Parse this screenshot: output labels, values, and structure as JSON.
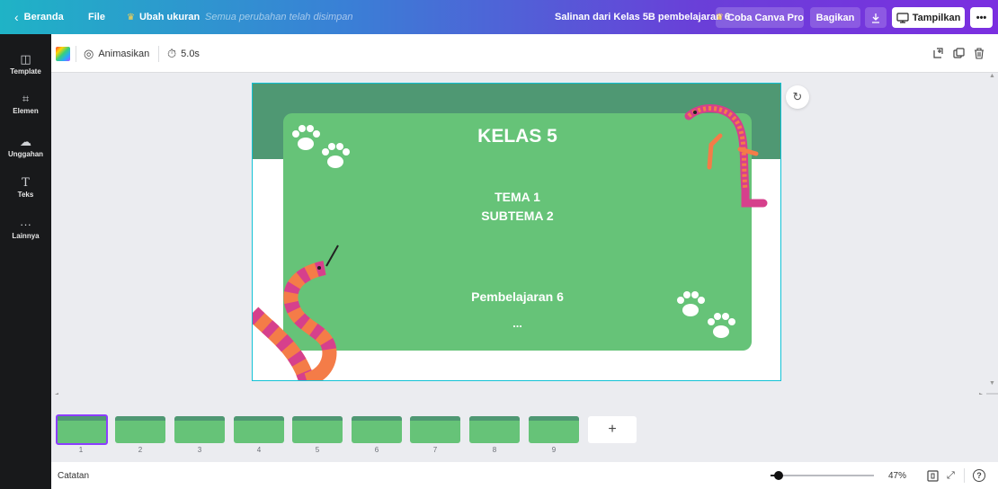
{
  "topbar": {
    "back_label": "Beranda",
    "file_label": "File",
    "resize_label": "Ubah ukuran",
    "saved_status": "Semua perubahan telah disimpan",
    "doc_title": "Salinan dari Kelas 5B pembelajaran 6",
    "pro_label": "Coba Canva Pro",
    "share_label": "Bagikan",
    "present_label": "Tampilkan",
    "more_label": "•••"
  },
  "sidebar": {
    "items": [
      {
        "label": "Template",
        "icon": "template-icon"
      },
      {
        "label": "Elemen",
        "icon": "elements-icon"
      },
      {
        "label": "Unggahan",
        "icon": "upload-icon"
      },
      {
        "label": "Teks",
        "icon": "text-icon"
      },
      {
        "label": "Lainnya",
        "icon": "more-icon"
      }
    ]
  },
  "toolbar": {
    "animate_label": "Animasikan",
    "duration": "5.0s"
  },
  "slide": {
    "title": "KELAS 5",
    "line1": "TEMA 1",
    "line2": "SUBTEMA 2",
    "subtitle": "Pembelajaran 6",
    "dots": "..."
  },
  "thumbnails": {
    "items": [
      "1",
      "2",
      "3",
      "4",
      "5",
      "6",
      "7",
      "8",
      "9"
    ],
    "add_label": "+"
  },
  "bottombar": {
    "notes_label": "Catatan",
    "zoom": "47%",
    "zoom_level": 0.47
  },
  "colors": {
    "accent": "#7d2ae8",
    "selected_border": "#8b3dff",
    "slide_band": "#4f9873",
    "slide_panel": "#66c378",
    "snake_orange": "#f47c48",
    "snake_pink": "#d6408c"
  }
}
